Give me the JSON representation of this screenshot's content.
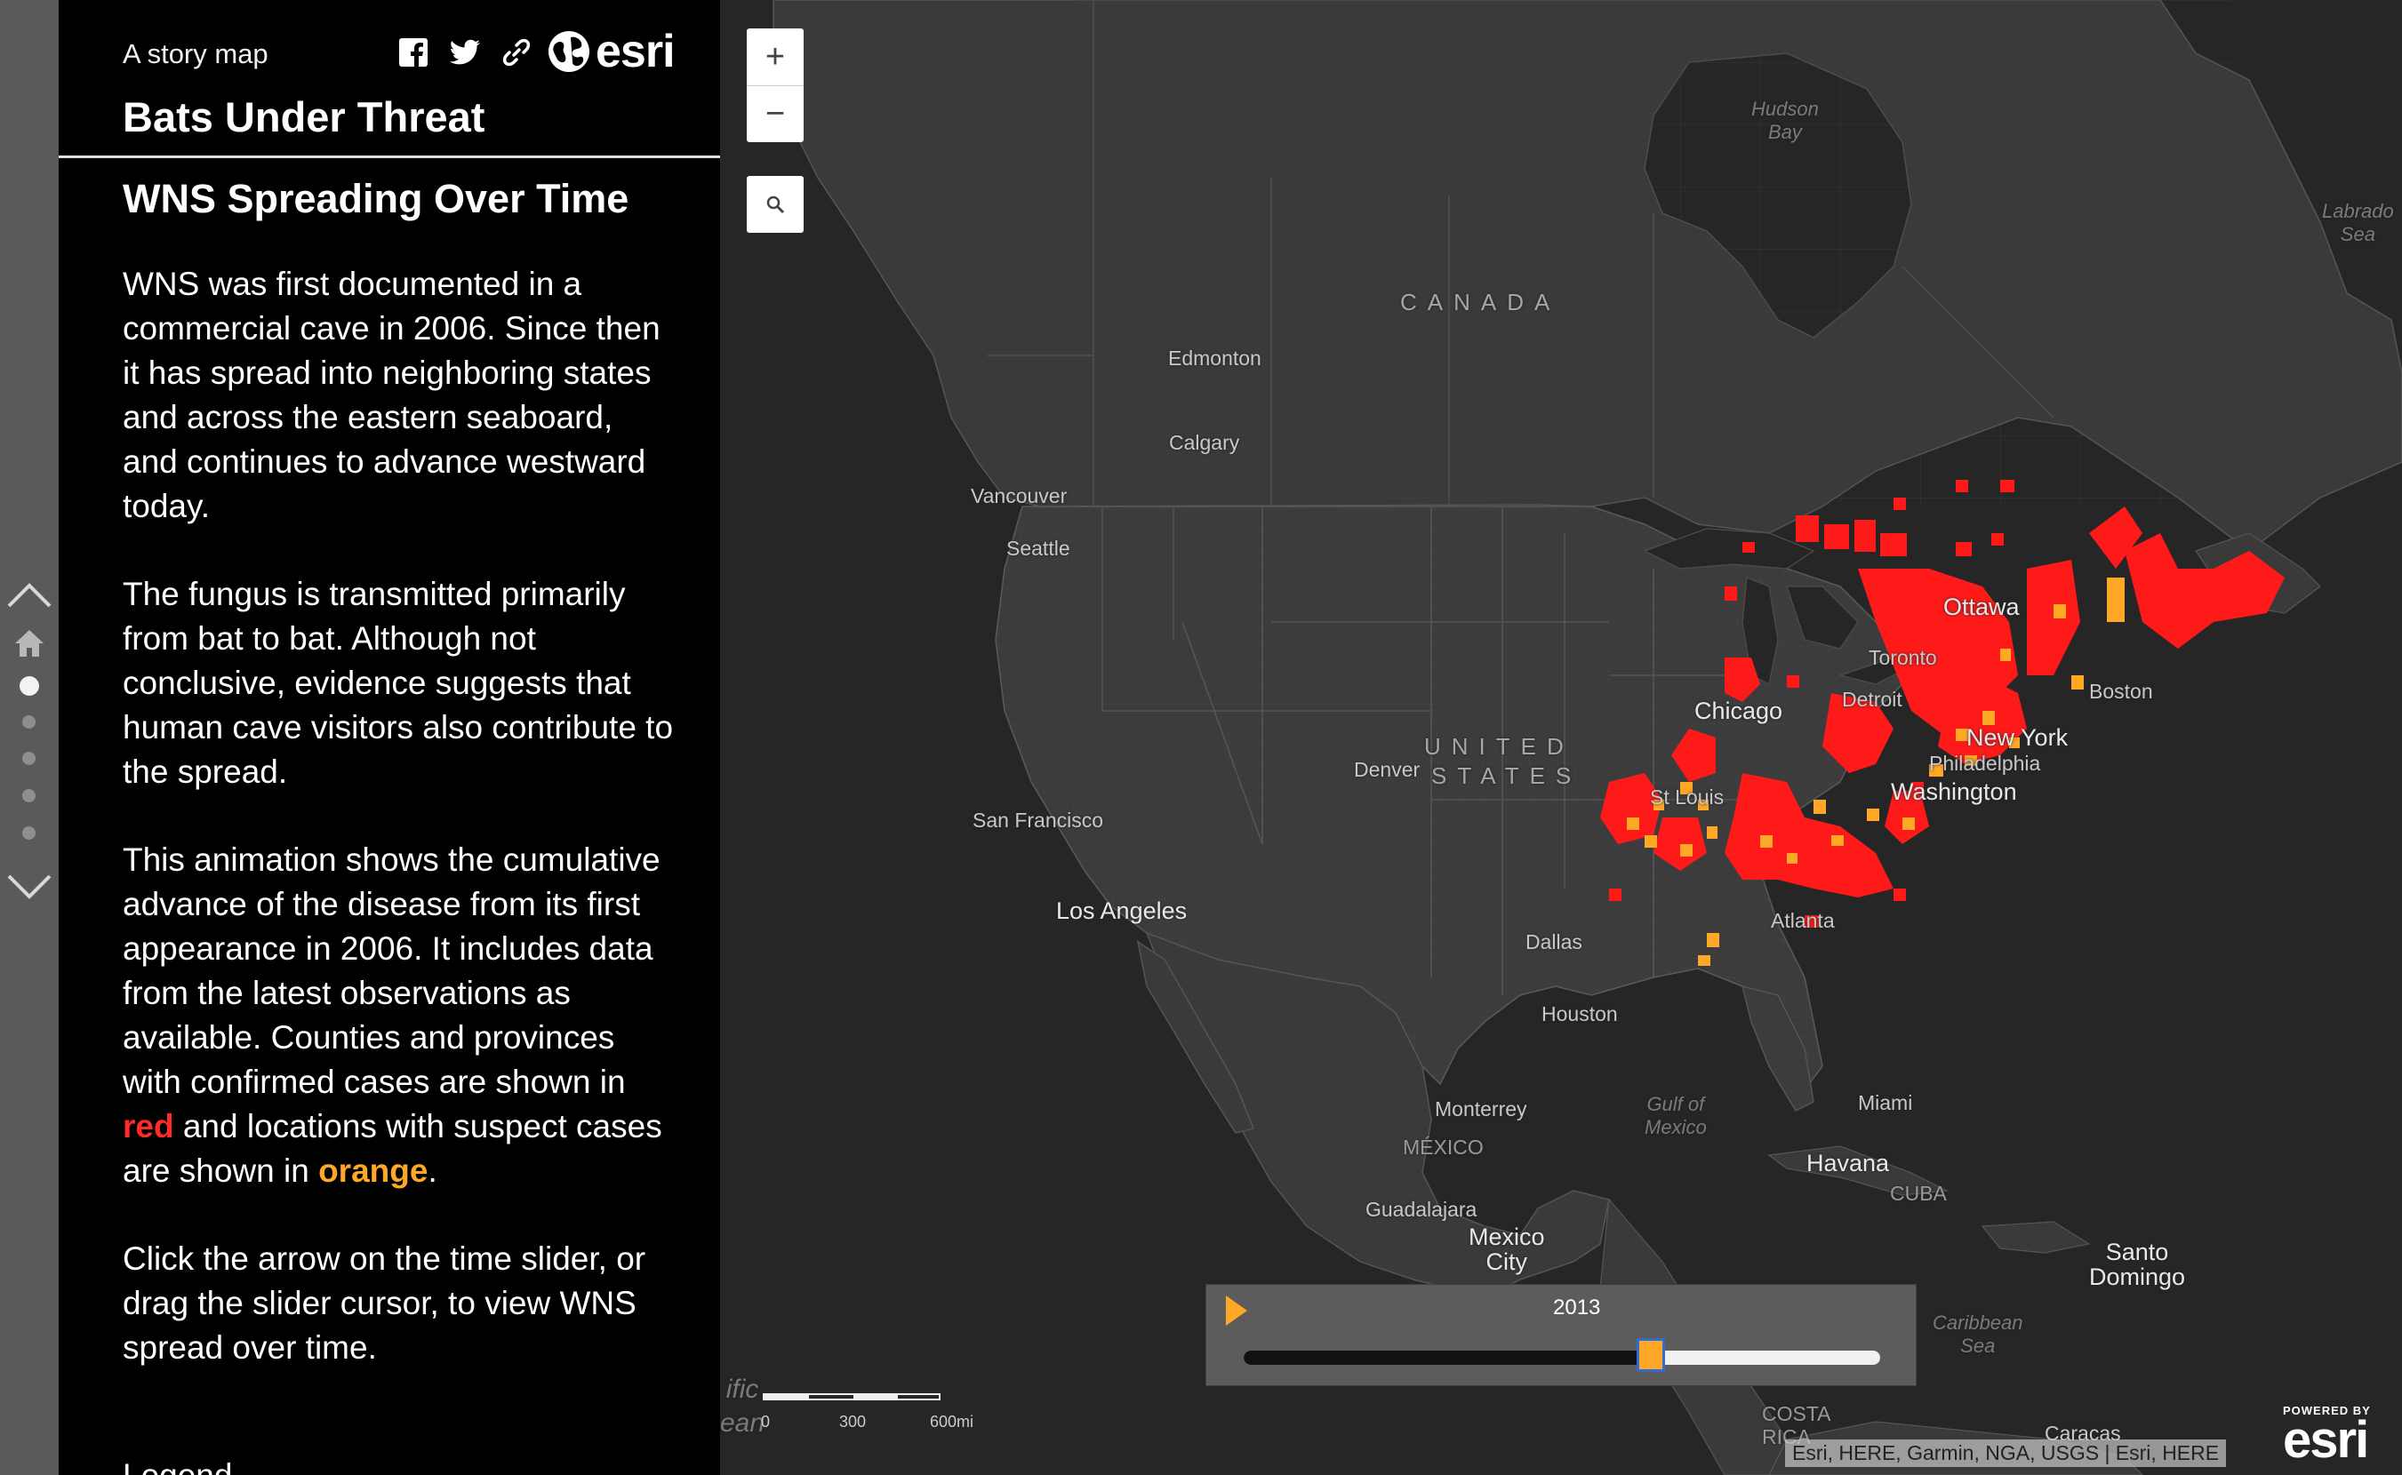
{
  "header": {
    "subtitle": "A story map",
    "title": "Bats Under Threat",
    "share_icons": [
      "facebook-icon",
      "twitter-icon",
      "link-icon"
    ],
    "logo_text": "esri"
  },
  "nav": {
    "up_icon": "chevron-up-icon",
    "home_icon": "home-icon",
    "down_icon": "chevron-down-icon",
    "active_index": 0,
    "dot_count": 5
  },
  "section": {
    "title": "WNS Spreading Over Time",
    "p1": "WNS was first documented in a commercial cave in 2006. Since then it has spread into neighboring states and across the eastern seaboard, and continues to advance westward today.",
    "p2": "The fungus is transmitted primarily from bat to bat. Although not conclusive, evidence suggests that human cave visitors also contribute to the spread.",
    "p3_a": "This animation shows the cumulative advance of the disease from its first appearance in 2006. It includes data from the latest observations as available. Counties and provinces with confirmed cases are shown in ",
    "p3_red": "red",
    "p3_b": " and locations with suspect cases are shown in ",
    "p3_orange": "orange",
    "p3_c": ".",
    "p4": "Click the arrow on the time slider, or drag the slider cursor, to view WNS spread over time.",
    "legend_label": "Legend"
  },
  "map": {
    "zoom_in": "+",
    "zoom_out": "−",
    "search_icon": "search-icon",
    "labels": {
      "hudson_bay": "Hudson\nBay",
      "labrador_sea": "Labrado\nSea",
      "canada": "CANADA",
      "edmonton": "Edmonton",
      "calgary": "Calgary",
      "vancouver": "Vancouver",
      "seattle": "Seattle",
      "ottawa": "Ottawa",
      "toronto": "Toronto",
      "boston": "Boston",
      "detroit": "Detroit",
      "chicago": "Chicago",
      "new_york": "New York",
      "philadelphia": "Philadelphia",
      "washington": "Washington",
      "united": "UNITED",
      "states": "STATES",
      "denver": "Denver",
      "st_louis": "St Louis",
      "san_francisco": "San Francisco",
      "los_angeles": "Los Angeles",
      "atlanta": "Atlanta",
      "dallas": "Dallas",
      "houston": "Houston",
      "monterrey": "Monterrey",
      "mexico_country": "MÉXICO",
      "gulf_of_mexico": "Gulf of\nMexico",
      "miami": "Miami",
      "havana": "Havana",
      "cuba": "CUBA",
      "guadalajara": "Guadalajara",
      "mexico_city": "Mexico\nCity",
      "santo_domingo": "Santo\nDomingo",
      "caribbean_sea": "Caribbean\nSea",
      "costa_rica": "COSTA\nRICA",
      "caracas": "Caracas",
      "pacific": "ific\nean"
    },
    "time_slider": {
      "year": "2013",
      "play_icon": "play-icon",
      "progress": 0.64
    },
    "scale": {
      "labels": [
        "0",
        "300",
        "600mi"
      ]
    },
    "attribution": "Esri, HERE, Garmin, NGA, USGS | Esri, HERE",
    "powered_by": "POWERED BY",
    "powered_logo": "esri",
    "colors": {
      "confirmed": "#ff1a1a",
      "suspect": "#ffa726",
      "land": "#3c3c3c",
      "water": "#262626"
    }
  }
}
